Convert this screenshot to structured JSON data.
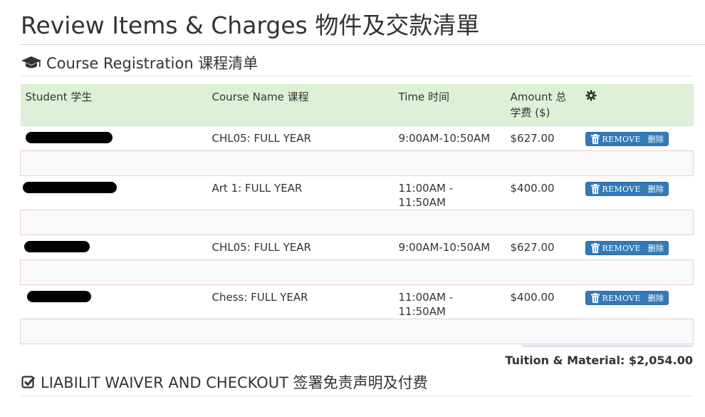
{
  "page": {
    "title": "Review Items & Charges 物件及交款清單"
  },
  "course_section": {
    "title": "Course Registration 课程清单",
    "icon": "graduation-cap-icon"
  },
  "table": {
    "headers": {
      "student": "Student 学生",
      "course": "Course Name 课程",
      "time": "Time 时间",
      "amount": "Amount 总学费 ($)",
      "settings_icon": "gear-icon"
    },
    "rows": [
      {
        "student": "",
        "course": "CHL05: FULL YEAR",
        "time": "9:00AM-10:50AM",
        "amount": "$627.00"
      },
      {
        "student": "",
        "course": "Art 1: FULL YEAR",
        "time": "11:00AM - 11:50AM",
        "amount": "$400.00"
      },
      {
        "student": "",
        "course": "CHL05: FULL YEAR",
        "time": "9:00AM-10:50AM",
        "amount": "$627.00"
      },
      {
        "student": "",
        "course": "Chess: FULL YEAR",
        "time": "11:00AM - 11:50AM",
        "amount": "$400.00"
      }
    ],
    "remove_label": "REMOVE",
    "remove_label_cn": "删除"
  },
  "totals": {
    "tuition_material": "Tuition & Material: $2,054.00"
  },
  "waiver_section": {
    "title": "LIABILIT WAIVER AND CHECKOUT 签署免责声明及付费",
    "icon": "checkbox-checked-icon"
  },
  "colors": {
    "header_bg": "#dff0d8",
    "button_bg": "#337ab7",
    "detail_border": "#ebccd1"
  }
}
